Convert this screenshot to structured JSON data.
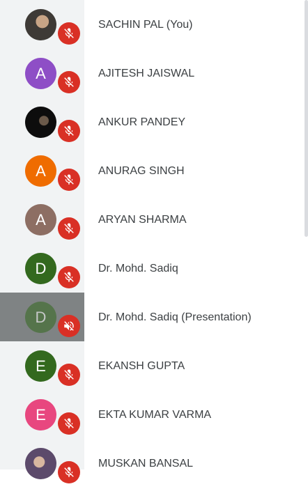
{
  "participants": [
    {
      "name": "SACHIN PAL (You)",
      "avatar": {
        "type": "photo",
        "style": "photo1"
      },
      "mic": "muted"
    },
    {
      "name": "AJITESH JAISWAL",
      "avatar": {
        "type": "letter",
        "letter": "A",
        "color": "#8e4ec6"
      },
      "mic": "muted"
    },
    {
      "name": "ANKUR PANDEY",
      "avatar": {
        "type": "photo",
        "style": "photo2"
      },
      "mic": "muted"
    },
    {
      "name": "ANURAG SINGH",
      "avatar": {
        "type": "letter",
        "letter": "A",
        "color": "#ef6c00"
      },
      "mic": "muted"
    },
    {
      "name": "ARYAN SHARMA",
      "avatar": {
        "type": "letter",
        "letter": "A",
        "color": "#8d6e63"
      },
      "mic": "muted"
    },
    {
      "name": "Dr. Mohd. Sadiq",
      "avatar": {
        "type": "letter",
        "letter": "D",
        "color": "#33691e"
      },
      "mic": "muted"
    },
    {
      "name": "Dr. Mohd. Sadiq (Presentation)",
      "avatar": {
        "type": "letter",
        "letter": "D",
        "color": "#33691e"
      },
      "mic": "audio-off",
      "highlighted": true
    },
    {
      "name": "EKANSH GUPTA",
      "avatar": {
        "type": "letter",
        "letter": "E",
        "color": "#33691e"
      },
      "mic": "muted"
    },
    {
      "name": "EKTA KUMAR VARMA",
      "avatar": {
        "type": "letter",
        "letter": "E",
        "color": "#e8477f"
      },
      "mic": "muted"
    },
    {
      "name": "MUSKAN BANSAL",
      "avatar": {
        "type": "photo",
        "style": "photo3"
      },
      "mic": "muted"
    }
  ],
  "colors": {
    "mute_badge": "#d93025",
    "left_strip": "#f1f3f4",
    "highlight": "#7f8384",
    "name_text": "#3c4043"
  },
  "icons": {
    "muted": "mic-off-icon",
    "audio-off": "volume-off-icon"
  }
}
